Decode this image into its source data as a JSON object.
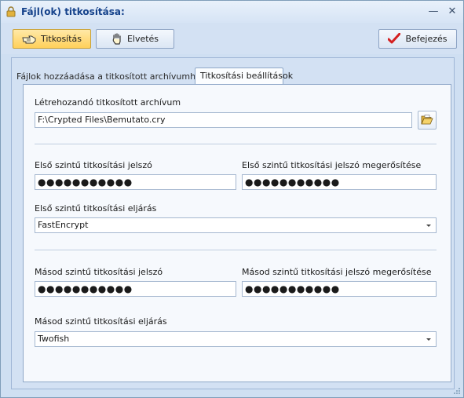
{
  "window": {
    "title": "Fájl(ok) titkosítása:"
  },
  "toolbar": {
    "encrypt_label": "Titkosítás",
    "discard_label": "Elvetés",
    "finish_label": "Befejezés"
  },
  "tabs": [
    {
      "label": "Fájlok hozzáadása a titkosított archívumhoz"
    },
    {
      "label": "Titkosítási beállítások"
    }
  ],
  "archive": {
    "label": "Létrehozandó titkosított archívum",
    "path": "F:\\Crypted Files\\Bemutato.cry"
  },
  "level1": {
    "password_label": "Első szintű titkosítási jelszó",
    "password_value": "●●●●●●●●●●●",
    "confirm_label": "Első szintű titkosítási jelszó megerősítése",
    "confirm_value": "●●●●●●●●●●●",
    "method_label": "Első szintű titkosítási eljárás",
    "method_value": "FastEncrypt"
  },
  "level2": {
    "password_label": "Másod szintű titkosítási jelszó",
    "password_value": "●●●●●●●●●●●",
    "confirm_label": "Másod szintű titkosítási jelszó megerősítése",
    "confirm_value": "●●●●●●●●●●●",
    "method_label": "Másod szintű titkosítási eljárás",
    "method_value": "Twofish"
  },
  "colors": {
    "accent_button": "#ffd05a",
    "title_text": "#15428b",
    "finish_check": "#d42020"
  },
  "icons": {
    "title": "lock-icon",
    "encrypt": "hand-pointer-icon",
    "discard": "hand-stop-icon",
    "finish": "checkmark-icon",
    "browse": "open-folder-icon"
  }
}
